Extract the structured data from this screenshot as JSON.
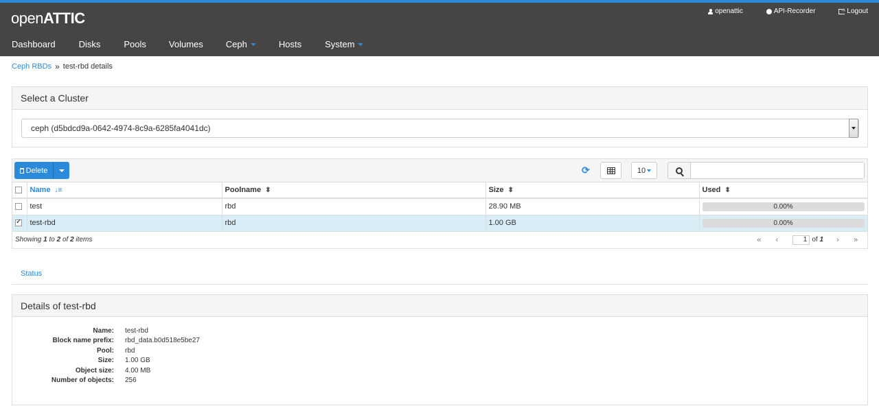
{
  "app": {
    "logo_open": "open",
    "logo_attic": "ATTIC"
  },
  "usernav": {
    "user": "openattic",
    "recorder": "API-Recorder",
    "logout": "Logout"
  },
  "nav": {
    "items": [
      "Dashboard",
      "Disks",
      "Pools",
      "Volumes",
      "Ceph",
      "Hosts",
      "System"
    ]
  },
  "breadcrumb": {
    "parent": "Ceph RBDs",
    "current": "test-rbd details"
  },
  "cluster_panel": {
    "title": "Select a Cluster",
    "selected": "ceph (d5bdcd9a-0642-4974-8c9a-6285fa4041dc)"
  },
  "toolbar": {
    "delete_label": "Delete",
    "page_size": "10",
    "search_placeholder": ""
  },
  "table": {
    "headers": [
      "Name",
      "Poolname",
      "Size",
      "Used"
    ],
    "rows": [
      {
        "name": "test",
        "pool": "rbd",
        "size": "28.90 MB",
        "used": "0.00%",
        "used_fraction": 0.0,
        "checked": false
      },
      {
        "name": "test-rbd",
        "pool": "rbd",
        "size": "1.00 GB",
        "used": "0.00%",
        "used_fraction": 0.0,
        "checked": true
      }
    ],
    "footer": {
      "showing": "Showing",
      "from": "1",
      "to_word": "to",
      "to": "2",
      "of_word": "of",
      "total": "2",
      "items_word": "items"
    },
    "pager": {
      "current": "1",
      "of_word": "of",
      "pages": "1"
    }
  },
  "tabs": {
    "status": "Status"
  },
  "details": {
    "title": "Details of test-rbd",
    "fields": [
      {
        "label": "Name:",
        "value": "test-rbd"
      },
      {
        "label": "Block name prefix:",
        "value": "rbd_data.b0d518e5be27"
      },
      {
        "label": "Pool:",
        "value": "rbd"
      },
      {
        "label": "Size:",
        "value": "1.00 GB"
      },
      {
        "label": "Object size:",
        "value": "4.00 MB"
      },
      {
        "label": "Number of objects:",
        "value": "256"
      }
    ]
  },
  "colors": {
    "accent": "#2b8ad9",
    "header_bg": "#474544",
    "selected_row": "#d9edf7"
  }
}
